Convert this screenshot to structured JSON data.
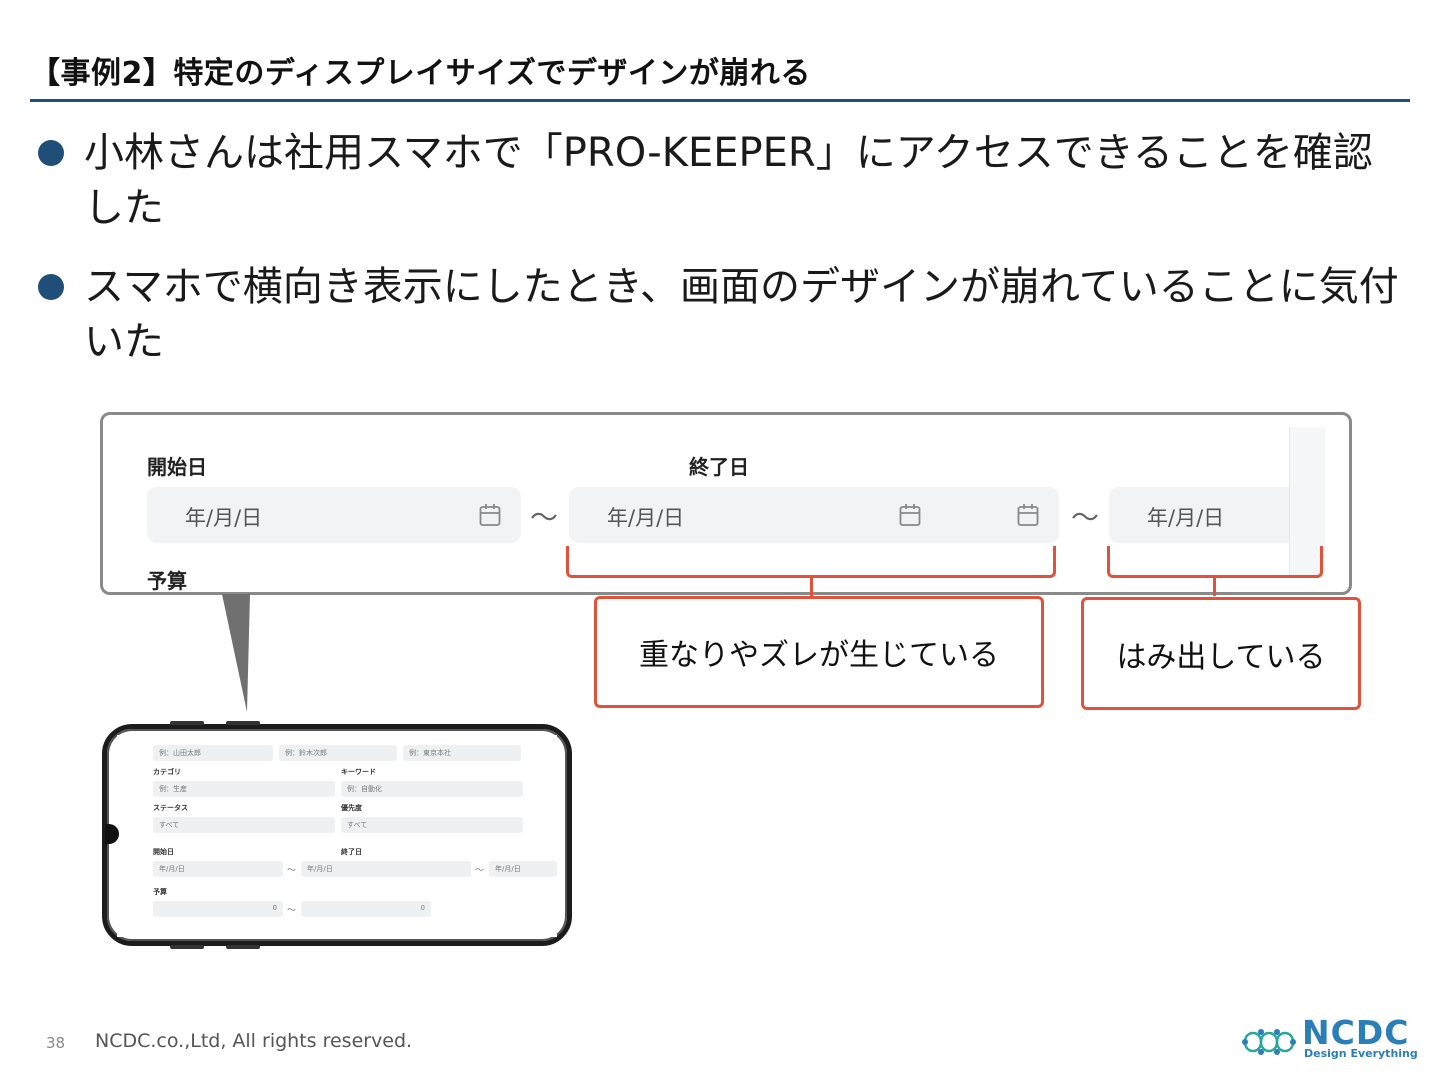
{
  "slide": {
    "title": "【事例2】特定のディスプレイサイズでデザインが崩れる",
    "bullets": [
      "小林さんは社用スマホで「PRO-KEEPER」にアクセスできることを確認した",
      "スマホで横向き表示にしたとき、画面のデザインが崩れていることに気付いた"
    ]
  },
  "zoom": {
    "start_label": "開始日",
    "end_label": "終了日",
    "budget_label": "予算",
    "date_placeholder": "年/月/日",
    "tilde": "〜"
  },
  "callouts": {
    "overlap": "重なりやズレが生じている",
    "overflow": "はみ出している"
  },
  "phone": {
    "fields_top": [
      "例：山田太郎",
      "例：鈴木次郎",
      "例：東京本社"
    ],
    "category_label": "カテゴリ",
    "keyword_label": "キーワード",
    "category_placeholder": "例：生産",
    "keyword_placeholder": "例：自動化",
    "status_label": "ステータス",
    "priority_label": "優先度",
    "status_value": "すべて",
    "priority_value": "すべて",
    "start_label": "開始日",
    "end_label": "終了日",
    "date_placeholder": "年/月/日",
    "budget_label": "予算",
    "budget_min": "0",
    "budget_max": "0",
    "tilde": "〜"
  },
  "footer": {
    "page_number": "38",
    "copyright": "NCDC.co.,Ltd, All rights reserved.",
    "logo_name": "NCDC",
    "logo_tagline": "Design Everything"
  },
  "colors": {
    "title_rule": "#1f4e79",
    "bullet": "#1f4e79",
    "callout_border": "#e0523a",
    "brand": "#2a7fb8"
  }
}
